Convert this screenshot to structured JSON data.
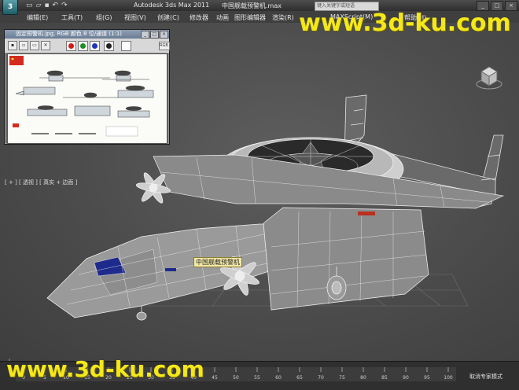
{
  "titlebar": {
    "app_title": "Autodesk 3ds Max  2011",
    "file_name": "中国舰载预警机.max",
    "search_placeholder": "键入关键字或短语",
    "logo_glyph": "3"
  },
  "menu": [
    {
      "label": "编辑(E)"
    },
    {
      "label": "工具(T)"
    },
    {
      "label": "组(G)"
    },
    {
      "label": "视图(V)"
    },
    {
      "label": "创建(C)"
    },
    {
      "label": "修改器"
    },
    {
      "label": "动画"
    },
    {
      "label": "图形编辑器"
    },
    {
      "label": "渲染(R)"
    },
    {
      "label": "MAXScript(M)"
    },
    {
      "label": "帮助(H)"
    }
  ],
  "viewport": {
    "label": "[ + ] [ 透视 ] [ 真实 + 边面 ]",
    "object_label": "中国舰载预警机",
    "viewcube_face": "TOP"
  },
  "reference_window": {
    "title": "固定预警机.jpg, RGB 颜色 8 位/通道 (1:1)",
    "channel_select": "RGB Alpha",
    "tools": [
      "save",
      "copy",
      "clone",
      "clear"
    ]
  },
  "timeline": {
    "ticks": [
      "0",
      "5",
      "10",
      "15",
      "20",
      "25",
      "30",
      "35",
      "40",
      "45",
      "50",
      "55",
      "60",
      "65",
      "70",
      "75",
      "80",
      "85",
      "90",
      "95",
      "100"
    ]
  },
  "status": {
    "mode_text": "取消专家模式"
  },
  "watermarks": {
    "top": "www.3d-ku.com",
    "bottom": "www.3d-ku.com"
  },
  "colors": {
    "viewport_bg": "#4b4b4b",
    "wireframe": "#e6e6e6",
    "watermark": "#f4e81a"
  }
}
